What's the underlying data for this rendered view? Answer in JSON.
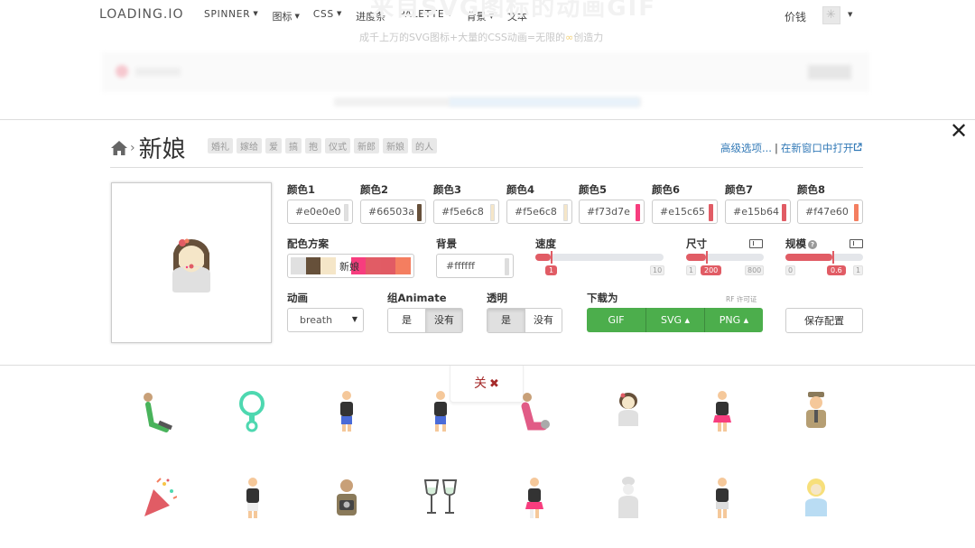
{
  "nav": {
    "logo": "LOADING.IO",
    "items": [
      {
        "label": "SPINNER",
        "dropdown": true,
        "latin": true
      },
      {
        "label": "图标",
        "dropdown": true,
        "latin": false
      },
      {
        "label": "CSS",
        "dropdown": true,
        "latin": true
      },
      {
        "label": "进度条",
        "dropdown": false,
        "latin": false
      },
      {
        "label": "PALETTE",
        "dropdown": true,
        "latin": true
      },
      {
        "label": "背景",
        "dropdown": true,
        "latin": false
      },
      {
        "label": "文本",
        "dropdown": false,
        "latin": false
      }
    ],
    "price": "价钱"
  },
  "hero": {
    "title": "来自SVG图标的动画GIF",
    "subtitle_a": "成千上万的SVG图标+大量的CSS动画=",
    "subtitle_b": "无限的",
    "subtitle_infinity": "∞",
    "subtitle_c": "创造力"
  },
  "panel": {
    "title": "新娘",
    "tags": [
      "婚礼",
      "嫁给",
      "爱",
      "搞",
      "抱",
      "仪式",
      "新郎",
      "新娘",
      "的人"
    ],
    "advanced_link": "高级选项...",
    "separator": "|",
    "new_window_link": "在新窗口中打开",
    "colors": [
      {
        "label": "颜色1",
        "value": "#e0e0e0",
        "swatch": "#e0e0e0"
      },
      {
        "label": "颜色2",
        "value": "#66503a",
        "swatch": "#66503a"
      },
      {
        "label": "颜色3",
        "value": "#f5e6c8",
        "swatch": "#f5e6c8"
      },
      {
        "label": "颜色4",
        "value": "#f5e6c8",
        "swatch": "#f5e6c8"
      },
      {
        "label": "颜色5",
        "value": "#f73d7e",
        "swatch": "#f73d7e"
      },
      {
        "label": "颜色6",
        "value": "#e15c65",
        "swatch": "#e15c65"
      },
      {
        "label": "颜色7",
        "value": "#e15b64",
        "swatch": "#e15b64"
      },
      {
        "label": "颜色8",
        "value": "#f47e60",
        "swatch": "#f47e60"
      }
    ],
    "scheme": {
      "label": "配色方案",
      "name": "新娘",
      "colors": [
        "#e0e0e0",
        "#66503a",
        "#f5e6c8",
        "#ffffff",
        "#f73d7e",
        "#e15c65",
        "#e15b64",
        "#f47e60"
      ]
    },
    "background": {
      "label": "背景",
      "value": "#ffffff"
    },
    "speed": {
      "label": "速度",
      "value": "1",
      "min": "1",
      "max": "10",
      "fraction": 0.12
    },
    "size": {
      "label": "尺寸",
      "value": "200",
      "min": "1",
      "max": "800",
      "fraction": 0.25
    },
    "scale": {
      "label": "规模",
      "value": "0.6",
      "min": "0",
      "max": "1",
      "fraction": 0.6
    },
    "animation": {
      "label": "动画",
      "value": "breath"
    },
    "group_animate": {
      "label": "组Animate",
      "options": [
        "是",
        "没有"
      ],
      "selected": 1
    },
    "transparent": {
      "label": "透明",
      "options": [
        "是",
        "没有"
      ],
      "selected": 0
    },
    "download": {
      "label": "下载为",
      "license": "RF 许可证",
      "buttons": [
        "GIF",
        "SVG ▴",
        "PNG ▴"
      ]
    },
    "save": "保存配置",
    "close_tab": "关"
  },
  "colors": {
    "accent_red": "#e15c65",
    "link_blue": "#337ab7",
    "download_green": "#4cae4c"
  }
}
